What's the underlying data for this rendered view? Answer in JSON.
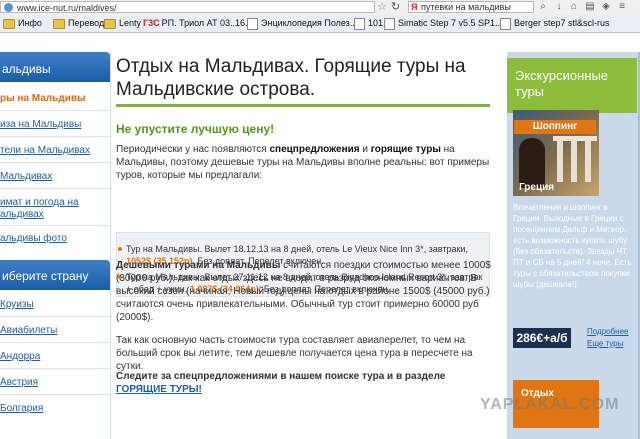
{
  "address_bar": {
    "url": "www.ice-nut.ru/maldives/",
    "search_text": "путевки на мальдивы",
    "yandex_label": "Я"
  },
  "bookmarks": [
    {
      "label": "Инфо",
      "kind": "folder"
    },
    {
      "label": "Перевод",
      "kind": "folder"
    },
    {
      "label": "Lenty",
      "kind": "folder"
    },
    {
      "label": "РП. Триол АТ 03..16. ...",
      "kind": "page",
      "prefix": "Г3С"
    },
    {
      "label": "Энциклопедия Полез...",
      "kind": "page"
    },
    {
      "label": "101",
      "kind": "page"
    },
    {
      "label": "Simatic Step 7 v5.5 SP1...",
      "kind": "page"
    },
    {
      "label": "Berger step7 stl&scl-rus",
      "kind": "page"
    }
  ],
  "sidebar": {
    "header": "альдивы",
    "items": [
      {
        "label": "ры на Мальдивы",
        "active": true
      },
      {
        "label": "иза на Мальдивы",
        "active": false
      },
      {
        "label": "тели на Мальдивах",
        "active": false
      },
      {
        "label": "Мальдивах",
        "active": false
      },
      {
        "label": "имат и погода на",
        "label2": "альдивах",
        "active": false
      },
      {
        "label": "альдивы фото",
        "active": false
      }
    ],
    "country_header": "иберите страну",
    "countries": [
      "Круизы",
      "Авиабилеты",
      "Андорра",
      "Австрия",
      "Болгария"
    ]
  },
  "main": {
    "title": "Отдых на Мальдивах. Горящие туры на Мальдивские острова.",
    "subtitle": "Не упустите лучшую цену!",
    "intro": {
      "t1": "Периодически у нас появляются ",
      "b1": "спецпредложения",
      "t2": " и ",
      "b2": "горящие туры",
      "t3": " на Мальдивы, поэтому дешевые туры на Мальдивы вполне реальны: вот примеры туров, которые мы предлагали:"
    },
    "tours": [
      {
        "text": "Тур на Мальдивы. Вылет 18.12.13 на 8 дней, отель Le Vieux Nice Inn 3*, завтраки, ",
        "price": "1052$ (35 152р)",
        "tail": ". Без доплат. Перелет включен."
      },
      {
        "text": "Тур на Мальдивы. Вылет 27.11.12 на 8 дней, отель Biyadhoo Island Resort 3*, завтрак + обед + ужин, ",
        "price": "1 087$ (34 064р)",
        "tail": ". Без доплат. Перелет включен."
      }
    ],
    "para2": {
      "b": "Дешевыми турами на Мальдивы",
      "t": " считаются поездки стоимостью менее 1000$ (30000 руб.), так как отдых здесь не входит в разряд экономных вариантов. В высокий сезон (начиная, Новый год) цены на отдых в районе 1500$ (45000 руб.) считаются очень привлекательными. Обычный тур стоит примерно 60000 руб (2000$)."
    },
    "para3": "Так как основную часть стоимости тура составляет авиаперелет, то чем на больший срок вы летите, тем дешевле получается цена тура в пересчете на сутки.",
    "cta": {
      "t": "Следите за спецпредложениями в нашем поиске тура и в разделе ",
      "link": "ГОРЯЩИЕ ТУРЫ!"
    }
  },
  "right": {
    "header": "Экскурсионные туры",
    "badge": "Шоппинг",
    "caption": "Греция",
    "description": "Впечатления и шоппинг в Греции. Выходные в Греции с посещением Дельф и Метеор, есть возможность купить шубу (без обязательств). Заезды ЧТ, ПТ и СБ на 5 дней/ 4 ночи. Есть туры с обязательством покупки шубы (дешевле!)",
    "price": "286€+а/б",
    "links": [
      "Подробнее",
      "Еще туры"
    ],
    "bottom": "Отдых"
  },
  "watermark": "YAPLAKAL.COM"
}
